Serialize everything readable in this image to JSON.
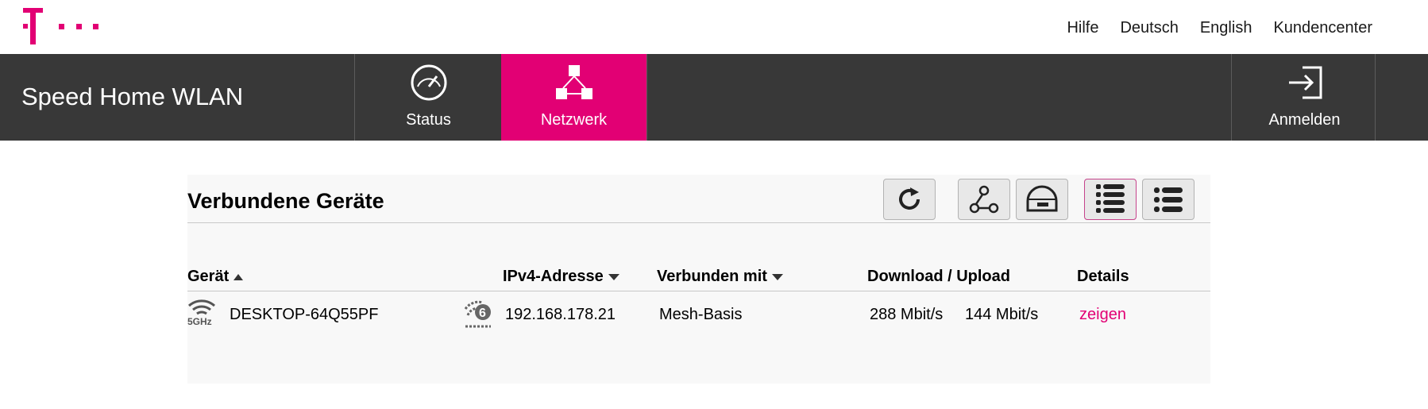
{
  "header": {
    "logo_icon": "telekom-t-logo",
    "links": [
      "Hilfe",
      "Deutsch",
      "English",
      "Kundencenter"
    ]
  },
  "nav": {
    "brand": "Speed Home WLAN",
    "tabs": [
      {
        "label": "Status",
        "icon": "speedometer-icon",
        "active": false
      },
      {
        "label": "Netzwerk",
        "icon": "network-icon",
        "active": true
      }
    ],
    "login": {
      "label": "Anmelden",
      "icon": "login-icon"
    }
  },
  "panel": {
    "title": "Verbundene Geräte",
    "toolbar": [
      "refresh-icon",
      "mesh-topology-icon",
      "router-icon",
      "list-view-icon",
      "detail-list-view-icon"
    ],
    "columns": [
      {
        "label": "Gerät",
        "sort": "asc"
      },
      {
        "label": "IPv4-Adresse",
        "sort": "desc"
      },
      {
        "label": "Verbunden mit",
        "sort": "desc"
      },
      {
        "label": "Download / Upload",
        "sort": null
      },
      {
        "label": "Details",
        "sort": null
      }
    ],
    "rows": [
      {
        "band_icon": "wifi-5ghz-icon",
        "band_label": "5GHz",
        "device": "DESKTOP-64Q55PF",
        "wifi6_label": "6",
        "ip": "192.168.178.21",
        "connected_to": "Mesh-Basis",
        "download": "288 Mbit/s",
        "upload": "144 Mbit/s",
        "details_link": "zeigen"
      }
    ]
  },
  "colors": {
    "magenta": "#e20074",
    "navbar": "#383838",
    "panel": "#f8f8f8"
  }
}
